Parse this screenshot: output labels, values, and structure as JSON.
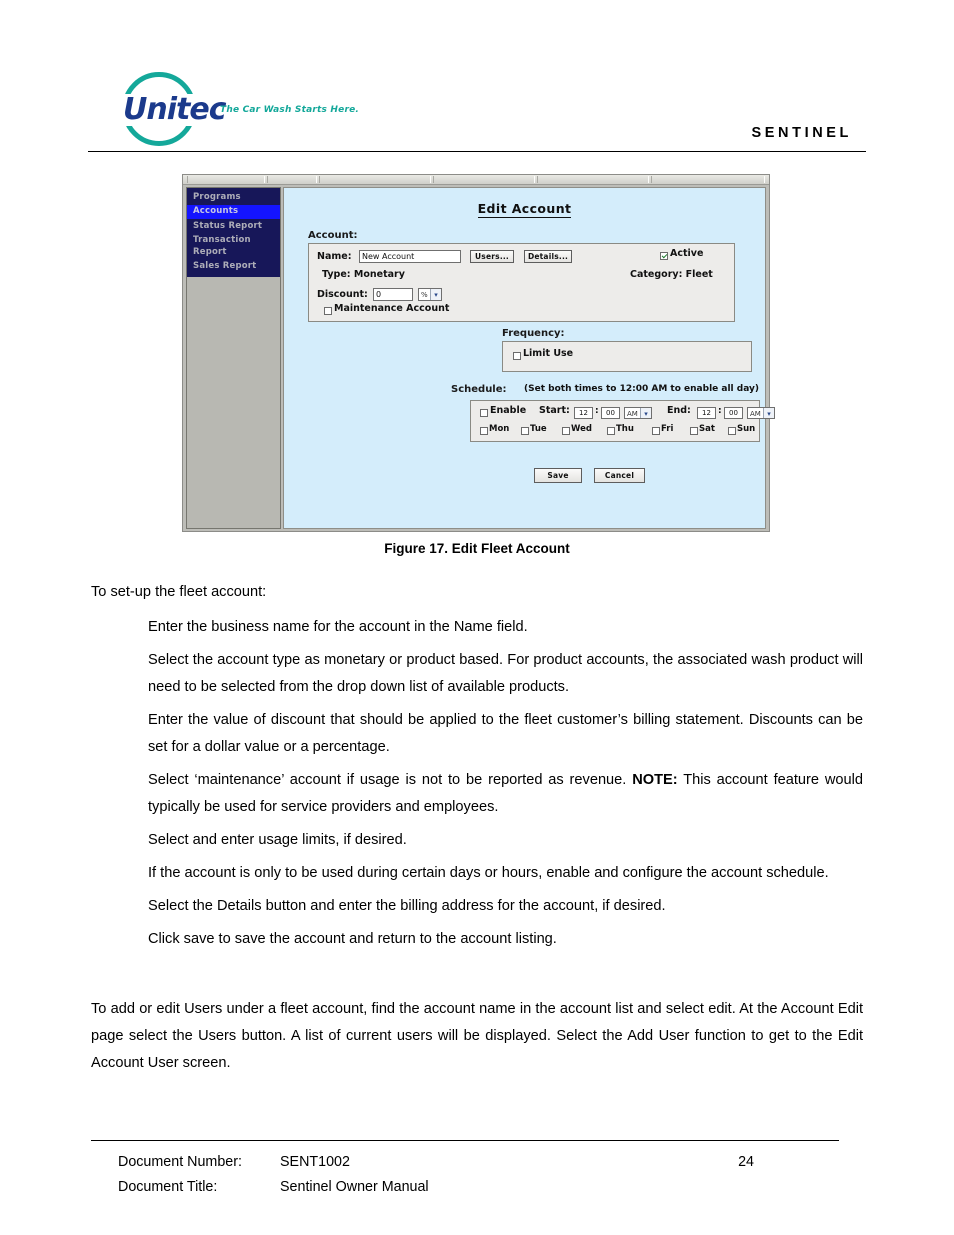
{
  "header": {
    "logo_word": "Unitec",
    "logo_tagline": "The Car Wash Starts Here.",
    "product_name": "SENTINEL"
  },
  "figure": {
    "caption": "Figure 17. Edit Fleet Account",
    "app": {
      "title": "Edit Account",
      "sidebar": [
        {
          "label": "Programs",
          "selected": false
        },
        {
          "label": "Accounts",
          "selected": true
        },
        {
          "label": "Status Report",
          "selected": false
        },
        {
          "label": "Transaction Report",
          "selected": false
        },
        {
          "label": "Sales Report",
          "selected": false
        }
      ],
      "account_section": {
        "label": "Account:",
        "name_label": "Name:",
        "name_value": "New Account",
        "users_button": "Users...",
        "details_button": "Details...",
        "active_label": "Active",
        "active_checked": true,
        "type_label": "Type:  Monetary",
        "category_label": "Category: Fleet",
        "discount_label": "Discount:",
        "discount_value": "0",
        "discount_unit": "%",
        "maintenance_label": "Maintenance Account",
        "maintenance_checked": false
      },
      "frequency_section": {
        "label": "Frequency:",
        "limit_use_label": "Limit Use",
        "limit_use_checked": false
      },
      "schedule_section": {
        "label": "Schedule:",
        "hint": "(Set both times to 12:00 AM to enable all day)",
        "enable_label": "Enable",
        "enable_checked": false,
        "start_label": "Start:",
        "start_hour": "12",
        "start_minute": "00",
        "start_meridiem": "AM",
        "end_label": "End:",
        "end_hour": "12",
        "end_minute": "00",
        "end_meridiem": "AM",
        "colon": ":",
        "days": [
          {
            "label": "Mon",
            "checked": false
          },
          {
            "label": "Tue",
            "checked": false
          },
          {
            "label": "Wed",
            "checked": false
          },
          {
            "label": "Thu",
            "checked": false
          },
          {
            "label": "Fri",
            "checked": false
          },
          {
            "label": "Sat",
            "checked": false
          },
          {
            "label": "Sun",
            "checked": false
          }
        ]
      },
      "save_button": "Save",
      "cancel_button": "Cancel"
    }
  },
  "body": {
    "lead": "To set-up the fleet account:",
    "steps": [
      "Enter the business name for the account in the Name field.",
      "Select the account type as monetary or product based. For product accounts, the associated wash product will need to be selected from the drop down list of available products.",
      "Enter the value of discount that should be applied to the fleet customer’s billing statement. Discounts can be set for a dollar value or a percentage.",
      "Select and enter usage limits, if desired.",
      "If the account is only to be used during certain days or hours, enable and configure the account schedule.",
      "Select the Details button and enter the billing address for the account, if desired.",
      "Click save to save the account and return to the account listing."
    ],
    "note_step": {
      "before": "Select ‘maintenance’ account if usage is not to be reported as revenue. ",
      "note_word": "NOTE:",
      "after": " This account feature would typically be used for service providers and employees."
    },
    "closing": "To add or edit Users under a fleet account, find the account name in the account list and select edit. At the Account Edit page select the Users button. A list of current users will be displayed. Select the Add User function to get to the Edit Account User screen."
  },
  "footer": {
    "doc_number_key": "Document Number:",
    "doc_number_value": "SENT1002",
    "doc_title_key": "Document Title:",
    "doc_title_value": "Sentinel Owner Manual",
    "page_number": "24"
  }
}
